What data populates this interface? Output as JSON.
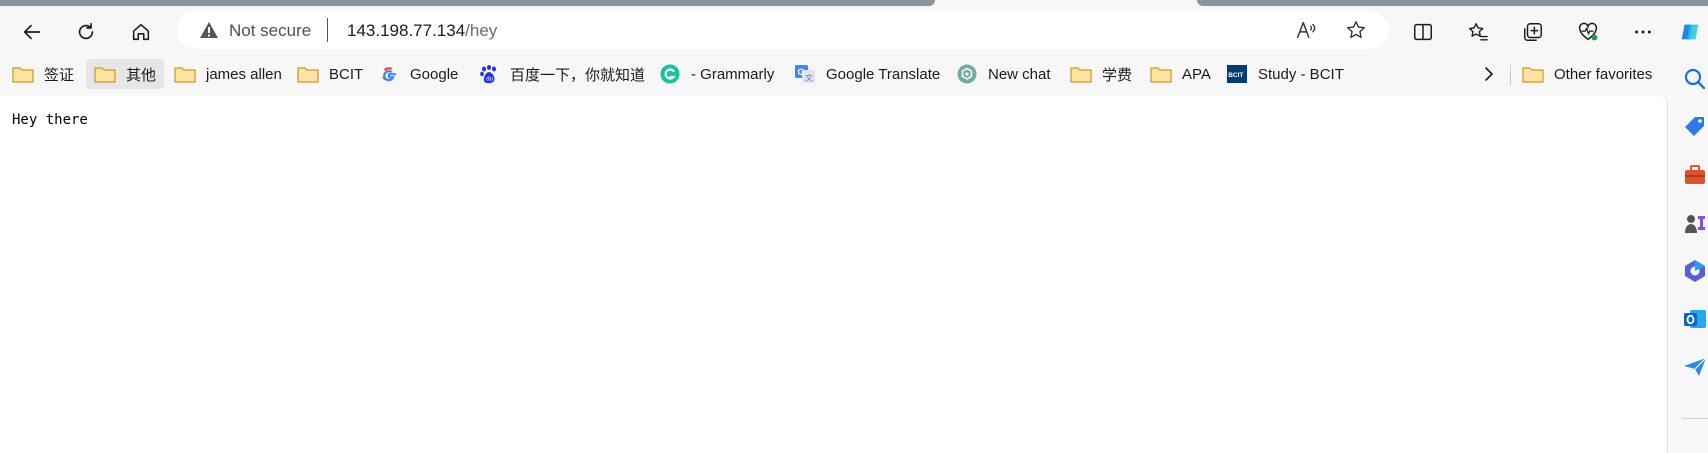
{
  "browser": {
    "security_label": "Not secure",
    "url_host": "143.198.77.134",
    "url_path": "/hey"
  },
  "favorites": [
    {
      "label": "签证",
      "icon": "folder-icon"
    },
    {
      "label": "其他",
      "icon": "folder-icon"
    },
    {
      "label": "james allen",
      "icon": "folder-icon"
    },
    {
      "label": "BCIT",
      "icon": "folder-icon"
    },
    {
      "label": "Google",
      "icon": "google-icon"
    },
    {
      "label": "百度一下，你就知道",
      "icon": "baidu-icon"
    },
    {
      "label": "- Grammarly",
      "icon": "grammarly-icon"
    },
    {
      "label": "Google Translate",
      "icon": "google-translate-icon"
    },
    {
      "label": "New chat",
      "icon": "chatgpt-icon"
    },
    {
      "label": "学费",
      "icon": "folder-icon"
    },
    {
      "label": "APA",
      "icon": "folder-icon"
    },
    {
      "label": "Study - BCIT",
      "icon": "bcit-icon"
    },
    {
      "label": "Other favorites",
      "icon": "folder-icon"
    }
  ],
  "bcit_icon_text": "BCIT",
  "page": {
    "text": "Hey there"
  },
  "colors": {
    "folder": "#f4c542",
    "accent": "#0078d4",
    "grammarly": "#15c39a"
  }
}
